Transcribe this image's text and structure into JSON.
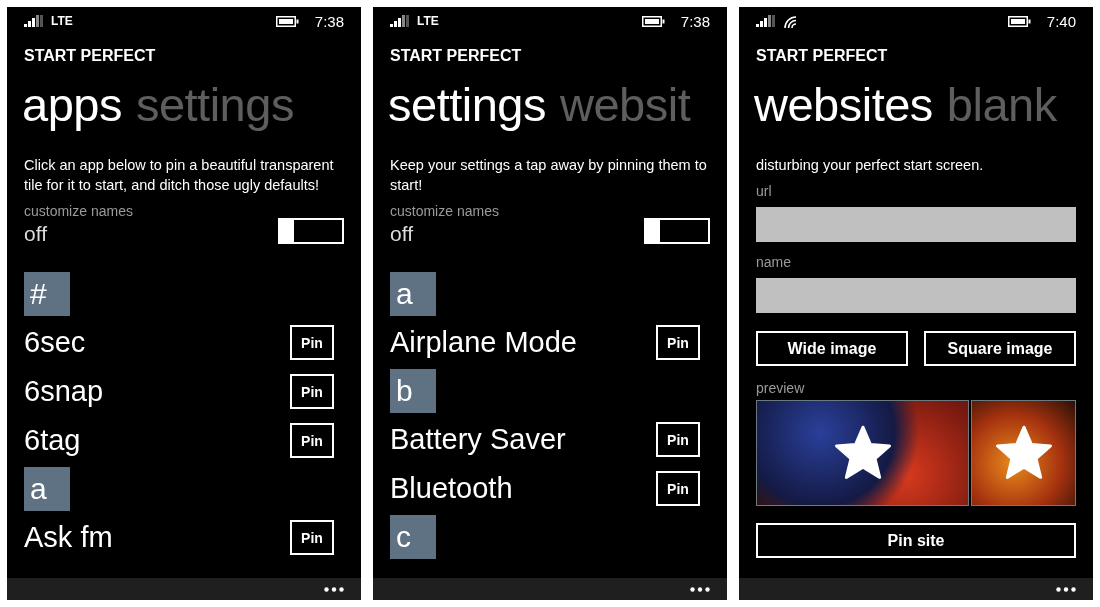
{
  "screens": [
    {
      "status": {
        "network": "LTE",
        "wifi": false,
        "time": "7:38"
      },
      "app_title": "START PERFECT",
      "pivots": [
        {
          "label": "apps",
          "selected": true
        },
        {
          "label": "settings",
          "selected": false
        }
      ],
      "content": [
        {
          "kind": "text",
          "text": "Click an app below to pin a beautiful transparent tile for it to start, and ditch those ugly defaults!"
        },
        {
          "kind": "toggle",
          "label": "customize names",
          "value": "off",
          "on": false
        },
        {
          "kind": "list",
          "items": [
            {
              "kind": "header",
              "text": "#"
            },
            {
              "kind": "item",
              "text": "6sec",
              "button": "Pin"
            },
            {
              "kind": "item",
              "text": "6snap",
              "button": "Pin"
            },
            {
              "kind": "item",
              "text": "6tag",
              "button": "Pin"
            },
            {
              "kind": "header",
              "text": "a"
            },
            {
              "kind": "item",
              "text": "Ask fm",
              "button": "Pin"
            }
          ]
        }
      ]
    },
    {
      "status": {
        "network": "LTE",
        "wifi": false,
        "time": "7:38"
      },
      "app_title": "START PERFECT",
      "pivots": [
        {
          "label": "settings",
          "selected": true
        },
        {
          "label": "websit",
          "selected": false
        }
      ],
      "content": [
        {
          "kind": "text",
          "text": "Keep your settings a tap away by pinning them to start!"
        },
        {
          "kind": "toggle",
          "label": "customize names",
          "value": "off",
          "on": false
        },
        {
          "kind": "list",
          "items": [
            {
              "kind": "header",
              "text": "a"
            },
            {
              "kind": "item",
              "text": "Airplane Mode",
              "button": "Pin"
            },
            {
              "kind": "header",
              "text": "b"
            },
            {
              "kind": "item",
              "text": "Battery Saver",
              "button": "Pin"
            },
            {
              "kind": "item",
              "text": "Bluetooth",
              "button": "Pin"
            },
            {
              "kind": "header",
              "text": "c"
            }
          ]
        }
      ]
    },
    {
      "status": {
        "wifi": true,
        "time": "7:40"
      },
      "app_title": "START PERFECT",
      "pivots": [
        {
          "label": "websites",
          "selected": true
        },
        {
          "label": "blank",
          "selected": false
        }
      ],
      "content": [
        {
          "kind": "text",
          "text": "disturbing your perfect start screen."
        },
        {
          "kind": "field",
          "label": "url"
        },
        {
          "kind": "field",
          "label": "name"
        },
        {
          "kind": "buttons",
          "buttons": [
            "Wide image",
            "Square image"
          ]
        },
        {
          "kind": "preview",
          "label": "preview"
        },
        {
          "kind": "button",
          "text": "Pin site"
        }
      ]
    }
  ]
}
